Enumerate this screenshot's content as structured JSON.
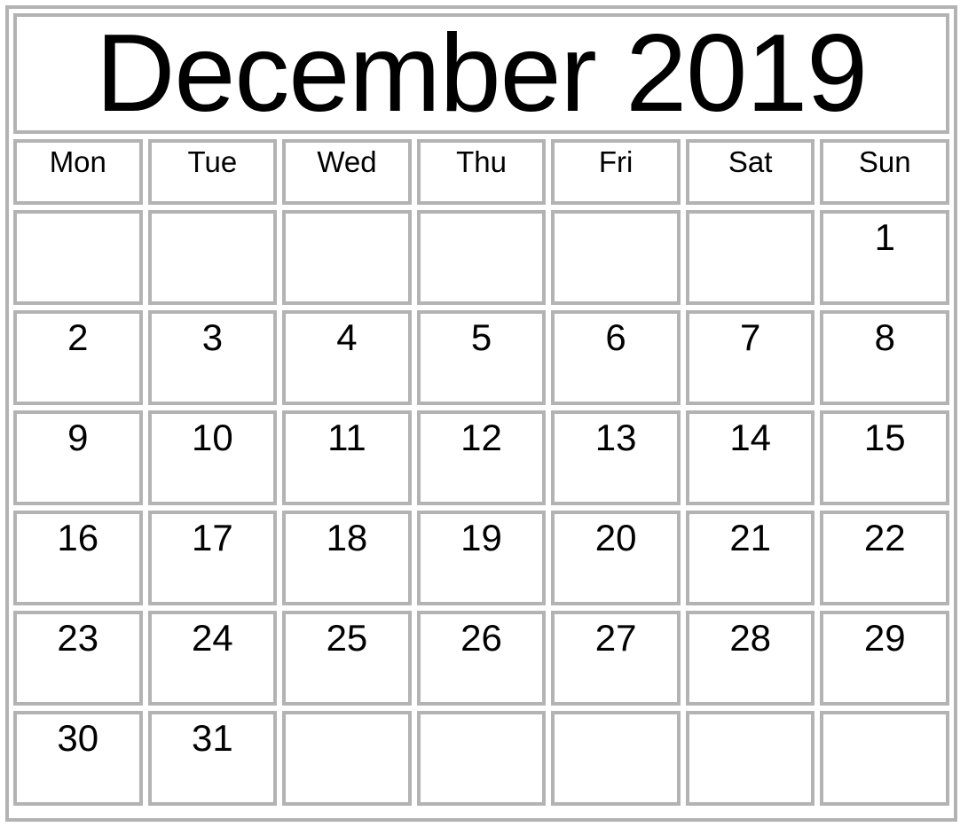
{
  "calendar": {
    "title": "December 2019",
    "month": "December",
    "year": "2019",
    "weekday_headers": [
      "Mon",
      "Tue",
      "Wed",
      "Thu",
      "Fri",
      "Sat",
      "Sun"
    ],
    "week_start": "Mon",
    "colors": {
      "border": "#b3b3b3",
      "text": "#000000",
      "background": "#ffffff"
    },
    "weeks": [
      {
        "days": [
          "",
          "",
          "",
          "",
          "",
          "",
          "1"
        ]
      },
      {
        "days": [
          "2",
          "3",
          "4",
          "5",
          "6",
          "7",
          "8"
        ]
      },
      {
        "days": [
          "9",
          "10",
          "11",
          "12",
          "13",
          "14",
          "15"
        ]
      },
      {
        "days": [
          "16",
          "17",
          "18",
          "19",
          "20",
          "21",
          "22"
        ]
      },
      {
        "days": [
          "23",
          "24",
          "25",
          "26",
          "27",
          "28",
          "29"
        ]
      },
      {
        "days": [
          "30",
          "31",
          "",
          "",
          "",
          "",
          ""
        ]
      }
    ]
  }
}
